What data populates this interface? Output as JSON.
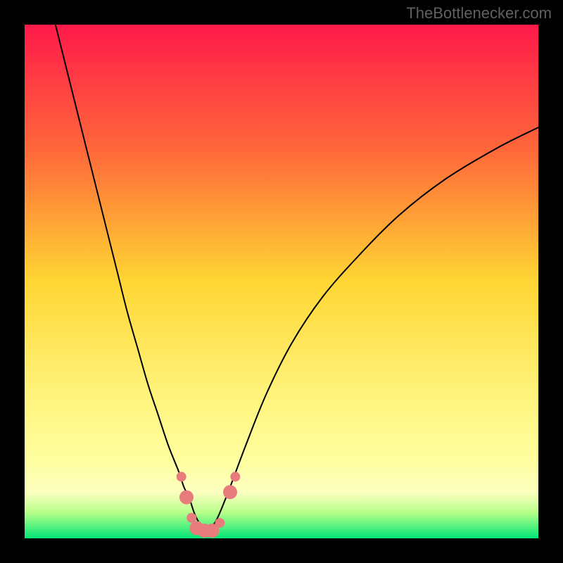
{
  "watermark": "TheBottlenecker.com",
  "chart_data": {
    "type": "line",
    "title": "",
    "xlabel": "",
    "ylabel": "",
    "xlim": [
      0,
      100
    ],
    "ylim": [
      0,
      100
    ],
    "grid": false,
    "background": {
      "type": "vertical-gradient",
      "stops": [
        {
          "pos": 0,
          "color": "#ff1a4a"
        },
        {
          "pos": 25,
          "color": "#ff6a3a"
        },
        {
          "pos": 50,
          "color": "#ffd633"
        },
        {
          "pos": 70,
          "color": "#fff176"
        },
        {
          "pos": 85,
          "color": "#ffffa0"
        },
        {
          "pos": 91,
          "color": "#fdffc0"
        },
        {
          "pos": 95,
          "color": "#b7ff8a"
        },
        {
          "pos": 100,
          "color": "#00e676"
        }
      ]
    },
    "series": [
      {
        "name": "curve",
        "color": "#000000",
        "width": 2,
        "x": [
          6,
          8,
          10,
          12,
          14,
          16,
          18,
          20,
          22,
          24,
          26,
          28,
          30,
          31,
          32,
          33,
          34,
          35,
          36,
          37,
          38,
          40,
          43,
          47,
          52,
          58,
          65,
          73,
          82,
          92,
          100
        ],
        "y": [
          100,
          92,
          84,
          76,
          68,
          60,
          52,
          44,
          37,
          30,
          24,
          18,
          13,
          10,
          8,
          5,
          3,
          2,
          2,
          3,
          5,
          10,
          18,
          28,
          38,
          47,
          55,
          63,
          70,
          76,
          80
        ]
      }
    ],
    "markers": {
      "name": "highlight-points",
      "color": "#e87c7c",
      "radius_small": 7,
      "radius_large": 10,
      "points": [
        {
          "x": 30.5,
          "y": 12,
          "r": "small"
        },
        {
          "x": 31.5,
          "y": 8,
          "r": "large"
        },
        {
          "x": 32.5,
          "y": 4,
          "r": "small"
        },
        {
          "x": 33.5,
          "y": 2,
          "r": "large"
        },
        {
          "x": 35,
          "y": 1.5,
          "r": "large"
        },
        {
          "x": 36.5,
          "y": 1.5,
          "r": "large"
        },
        {
          "x": 38,
          "y": 3,
          "r": "small"
        },
        {
          "x": 40,
          "y": 9,
          "r": "large"
        },
        {
          "x": 41,
          "y": 12,
          "r": "small"
        }
      ]
    }
  }
}
